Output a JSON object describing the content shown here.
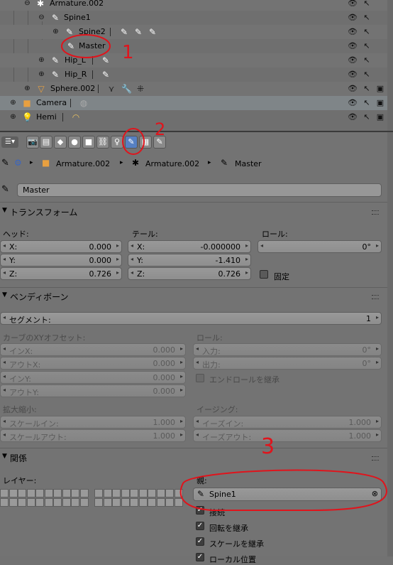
{
  "outliner": {
    "rows": [
      {
        "name": "Armature.002"
      },
      {
        "name": "Spine1"
      },
      {
        "name": "Spine2"
      },
      {
        "name": "Master"
      },
      {
        "name": "Hip_L"
      },
      {
        "name": "Hip_R"
      },
      {
        "name": "Sphere.002"
      },
      {
        "name": "Camera"
      },
      {
        "name": "Hemi"
      }
    ]
  },
  "breadcrumb": {
    "object": "Armature.002",
    "armature": "Armature.002",
    "bone": "Master"
  },
  "bone_name": "Master",
  "transform": {
    "title": "トランスフォーム",
    "head_label": "ヘッド:",
    "tail_label": "テール:",
    "roll_label": "ロール:",
    "head": {
      "x_label": "X:",
      "x": "0.000",
      "y_label": "Y:",
      "y": "0.000",
      "z_label": "Z:",
      "z": "0.726"
    },
    "tail": {
      "x_label": "X:",
      "x": "-0.000000",
      "y_label": "Y:",
      "y": "-1.410",
      "z_label": "Z:",
      "z": "0.726"
    },
    "roll": "0°",
    "lock_label": "固定"
  },
  "bendy": {
    "title": "ベンディボーン",
    "segments_label": "セグメント:",
    "segments": "1",
    "curve_label": "カーブのXYオフセット:",
    "in_x_label": "インX:",
    "in_x": "0.000",
    "out_x_label": "アウトX:",
    "out_x": "0.000",
    "in_y_label": "インY:",
    "in_y": "0.000",
    "out_y_label": "アウトY:",
    "out_y": "0.000",
    "roll_label": "ロール:",
    "roll_in_label": "入力:",
    "roll_in": "0°",
    "roll_out_label": "出力:",
    "roll_out": "0°",
    "inherit_end_roll": "エンドロールを継承",
    "scale_label": "拡大縮小:",
    "scale_in_label": "スケールイン:",
    "scale_in": "1.000",
    "scale_out_label": "スケールアウト:",
    "scale_out": "1.000",
    "easing_label": "イージング:",
    "ease_in_label": "イーズイン:",
    "ease_in": "1.000",
    "ease_out_label": "イーズアウト:",
    "ease_out": "1.000"
  },
  "relations": {
    "title": "関係",
    "layers_label": "レイヤー:",
    "parent_label": "親:",
    "parent": "Spine1",
    "connected": "接続",
    "inherit_rotation": "回転を継承",
    "inherit_scale": "スケールを継承",
    "local_location": "ローカル位置"
  },
  "annotations": {
    "mark1": "1",
    "mark2": "2",
    "mark3": "3"
  },
  "colors": {
    "annotation": "#e0141c",
    "active_tab": "#5680c2"
  }
}
